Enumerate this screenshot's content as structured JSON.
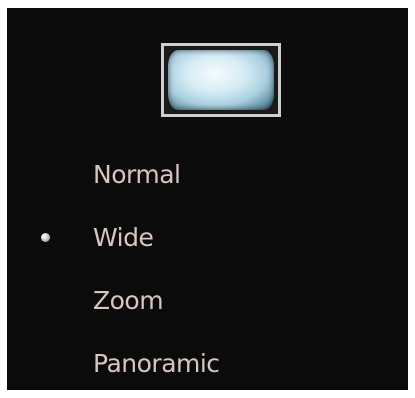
{
  "menu": {
    "preview_icon": "screen-preview-icon",
    "selected_index": 1,
    "options": [
      {
        "label": "Normal",
        "selected": false
      },
      {
        "label": "Wide",
        "selected": true
      },
      {
        "label": "Zoom",
        "selected": false
      },
      {
        "label": "Panoramic",
        "selected": false
      }
    ]
  },
  "colors": {
    "background": "#0b0b0b",
    "text": "#d7c6bf",
    "frame_border": "#cfcfcf",
    "selected_dot": "#cfcfcf"
  }
}
